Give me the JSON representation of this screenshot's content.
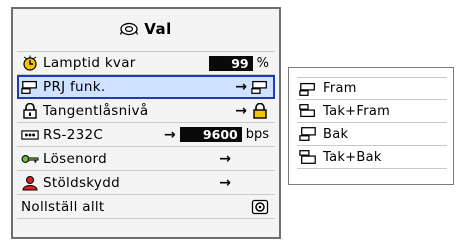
{
  "window": {
    "title": "Val"
  },
  "menu": {
    "items": [
      {
        "label": "Lamptid kvar",
        "value": "99",
        "unit": "%",
        "icon": "lamp-timer-icon"
      },
      {
        "label": "PRJ funk.",
        "arrow": "→",
        "icon": "projection-mode-icon"
      },
      {
        "label": "Tangentlåsnivå",
        "arrow": "→",
        "icon": "keylock-icon"
      },
      {
        "label": "RS-232C",
        "arrow": "→",
        "value": "9600",
        "unit": "bps",
        "icon": "rs232c-icon"
      },
      {
        "label": "Lösenord",
        "arrow": "→",
        "icon": "key-icon"
      },
      {
        "label": "Stöldskydd",
        "arrow": "→",
        "icon": "anti-theft-icon"
      },
      {
        "label": "Nollställ allt",
        "icon": "reset-icon"
      }
    ]
  },
  "submenu": {
    "items": [
      {
        "label": "Fram",
        "icon": "front-projection-icon"
      },
      {
        "label": "Tak+Fram",
        "icon": "ceiling-front-icon"
      },
      {
        "label": "Bak",
        "icon": "rear-projection-icon"
      },
      {
        "label": "Tak+Bak",
        "icon": "ceiling-rear-icon"
      }
    ]
  },
  "colors": {
    "selected_row": "#cfe2ff",
    "selected_border": "#1f3cb8",
    "value_box": "#0a0a0a"
  }
}
